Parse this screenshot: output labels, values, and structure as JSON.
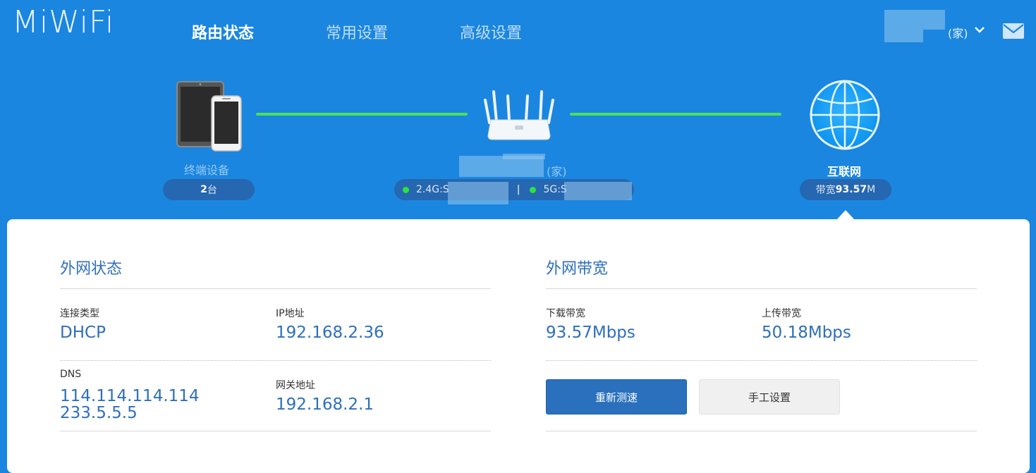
{
  "header": {
    "logo": "MiWiFi",
    "nav": [
      "路由状态",
      "常用设置",
      "高级设置"
    ],
    "router_suffix": "(家)"
  },
  "topology": {
    "devices": {
      "label": "终端设备",
      "count": "2",
      "count_unit": "台"
    },
    "router": {
      "name_suffix": "(家)",
      "wifi_24": "2.4G:S",
      "wifi_5": "5G:S",
      "separator": "|"
    },
    "internet": {
      "label": "互联网",
      "bandwidth_prefix": "带宽",
      "bandwidth_value": "93.57",
      "bandwidth_unit": "M"
    },
    "colors": {
      "background": "#1a86e0",
      "link": "#4de05a",
      "status_dot": "#2be33d"
    }
  },
  "wan": {
    "title": "外网状态",
    "conn_type_label": "连接类型",
    "conn_type_value": "DHCP",
    "ip_label": "IP地址",
    "ip_value": "192.168.2.36",
    "dns_label": "DNS",
    "dns_1": "114.114.114.114",
    "dns_2": "233.5.5.5",
    "gateway_label": "网关地址",
    "gateway_value": "192.168.2.1"
  },
  "bandwidth": {
    "title": "外网带宽",
    "download_label": "下载带宽",
    "download_value": "93.57Mbps",
    "upload_label": "上传带宽",
    "upload_value": "50.18Mbps",
    "retest_button": "重新测速",
    "manual_button": "手工设置"
  }
}
